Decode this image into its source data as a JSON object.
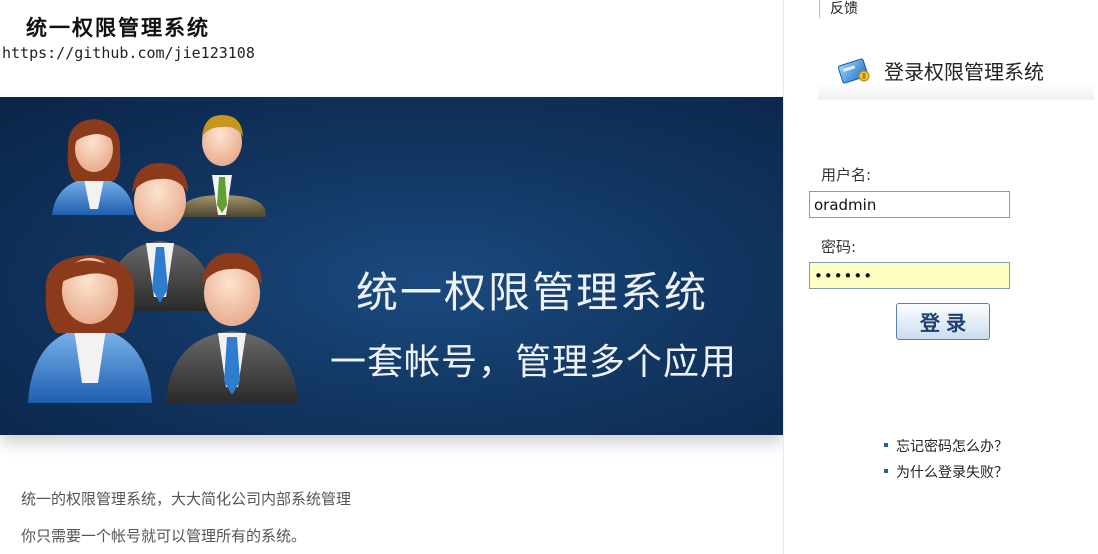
{
  "header": {
    "site_title": "统一权限管理系统",
    "site_url": "https://github.com/jie123108"
  },
  "banner": {
    "heading": "统一权限管理系统",
    "subheading": "一套帐号，管理多个应用",
    "illustration": "business-people-group"
  },
  "description": {
    "line1": "统一的权限管理系统，大大简化公司内部系统管理",
    "line2": "你只需要一个帐号就可以管理所有的系统。"
  },
  "topbar": {
    "feedback_label": "反馈"
  },
  "login": {
    "icon": "login-card-icon",
    "title": "登录权限管理系统",
    "username_label": "用户名:",
    "username_value": "oradmin",
    "password_label": "密码:",
    "password_value": "••••••",
    "submit_label": "登录"
  },
  "help": {
    "items": [
      {
        "label": "忘记密码怎么办？"
      },
      {
        "label": "为什么登录失败？"
      }
    ]
  },
  "colors": {
    "banner_bg": "#123763",
    "password_bg": "#ffffc4",
    "button_text": "#1d3f6e",
    "bullet": "#2a5d9c"
  }
}
